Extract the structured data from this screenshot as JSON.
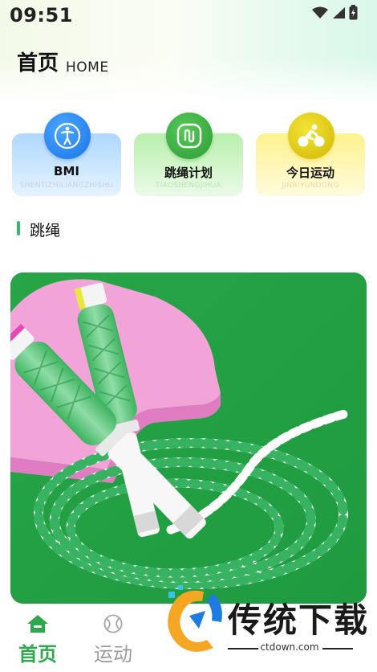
{
  "status_bar": {
    "time": "09:51"
  },
  "header": {
    "title": "首页",
    "subtitle": "HOME"
  },
  "cards": [
    {
      "label": "BMI",
      "pinyin": "SHENTIZHILIANGZHISHU",
      "icon": "body-icon",
      "color": "#1a73e8"
    },
    {
      "label": "跳绳计划",
      "pinyin": "TIAOSHENGJIHUA",
      "icon": "rope-icon",
      "color": "#2e9c35"
    },
    {
      "label": "今日运动",
      "pinyin": "JINRIYUNDONG",
      "icon": "cycling-icon",
      "color": "#d2b700"
    }
  ],
  "section": {
    "title": "跳绳"
  },
  "hero_image": {
    "subject": "jump-rope-photo"
  },
  "nav": [
    {
      "label": "首页",
      "icon": "home-icon",
      "active": true
    },
    {
      "label": "运动",
      "icon": "ball-icon",
      "active": false
    }
  ],
  "watermark": {
    "text": "传统下载",
    "url": "ctdown.com"
  },
  "colors": {
    "accent": "#2ea84c",
    "inactive": "#9a9a9a"
  }
}
